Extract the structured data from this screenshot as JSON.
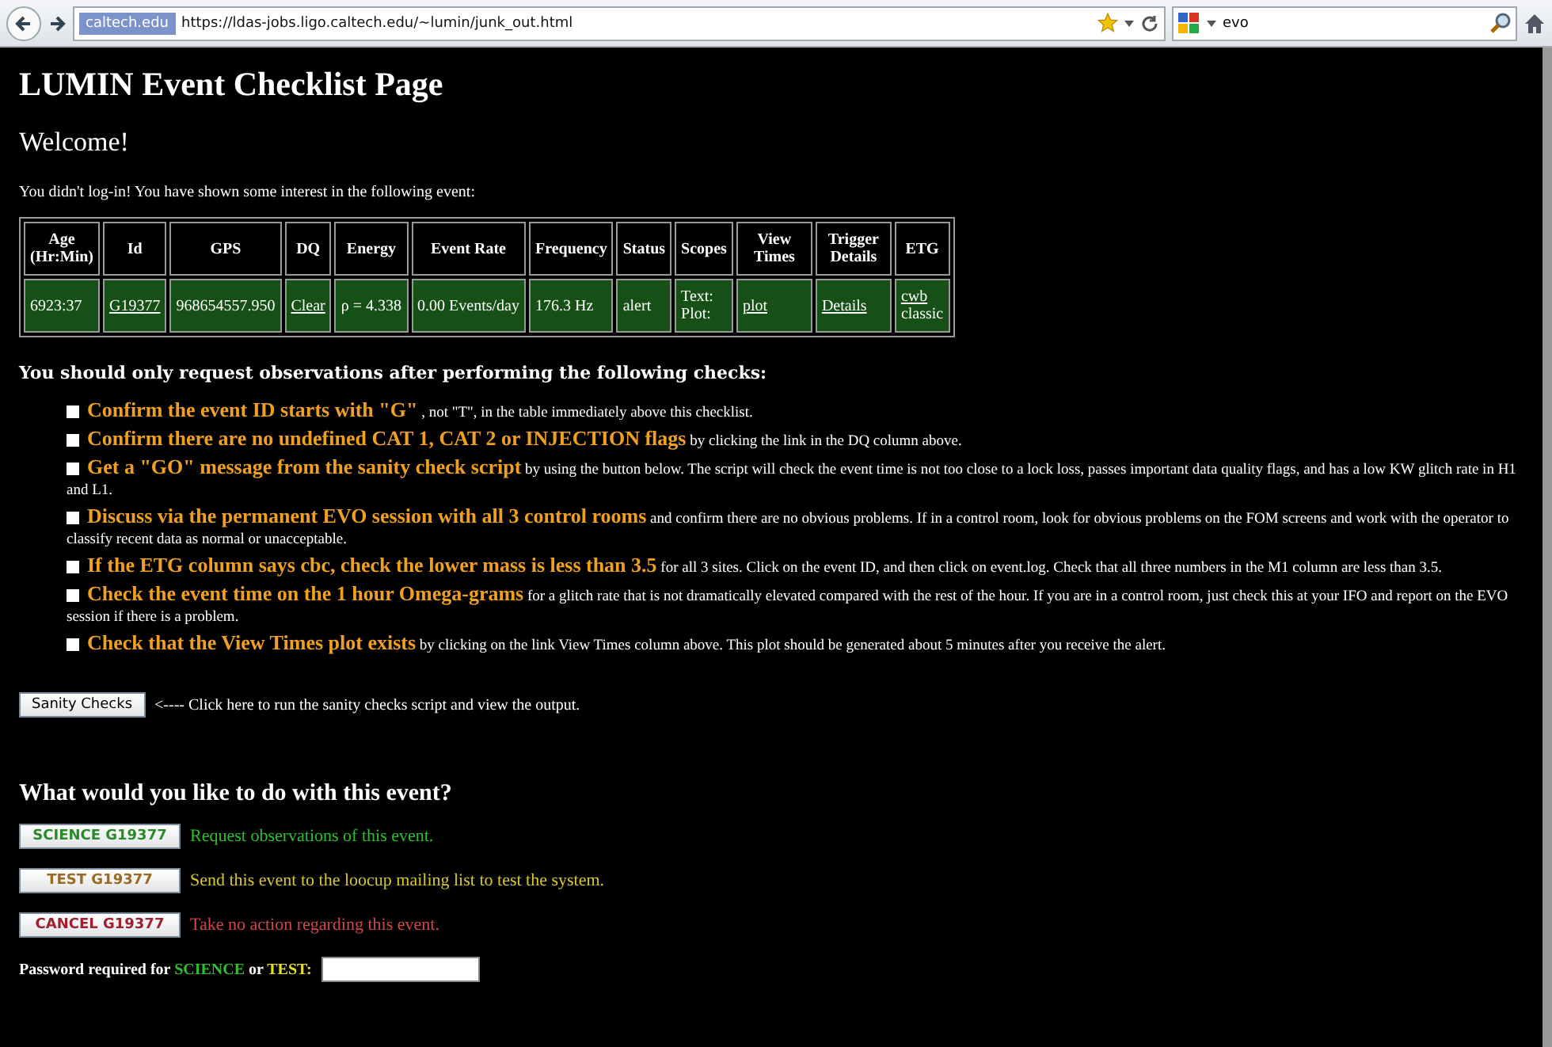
{
  "browser": {
    "site_badge": "caltech.edu",
    "url": "https://ldas-jobs.ligo.caltech.edu/~lumin/junk_out.html",
    "search_value": "evo"
  },
  "title": "LUMIN Event Checklist Page",
  "welcome": "Welcome!",
  "intro": "You didn't log-in! You have shown some interest in the following event:",
  "table": {
    "columns": [
      "Age (Hr:Min)",
      "Id",
      "GPS",
      "DQ",
      "Energy",
      "Event Rate",
      "Frequency",
      "Status",
      "Scopes",
      "View Times",
      "Trigger Details",
      "ETG"
    ],
    "rows": [
      [
        {
          "lines": [
            {
              "text": "6923:37",
              "link": false
            }
          ]
        },
        {
          "lines": [
            {
              "text": "G19377",
              "link": true
            }
          ]
        },
        {
          "lines": [
            {
              "text": "968654557.950",
              "link": false
            }
          ]
        },
        {
          "lines": [
            {
              "text": "Clear",
              "link": true
            }
          ]
        },
        {
          "lines": [
            {
              "text": "ρ = 4.338",
              "link": false
            }
          ]
        },
        {
          "lines": [
            {
              "text": "0.00 Events/day",
              "link": false
            }
          ]
        },
        {
          "lines": [
            {
              "text": "176.3 Hz",
              "link": false
            }
          ]
        },
        {
          "lines": [
            {
              "text": "alert",
              "link": false
            }
          ]
        },
        {
          "lines": [
            {
              "text": "Text:",
              "link": false
            },
            {
              "text": "Plot:",
              "link": false
            }
          ]
        },
        {
          "lines": [
            {
              "text": "plot",
              "link": true
            }
          ]
        },
        {
          "lines": [
            {
              "text": "Details",
              "link": true
            }
          ]
        },
        {
          "lines": [
            {
              "text": "cwb",
              "link": true
            },
            {
              "text": "classic",
              "link": false
            }
          ]
        }
      ]
    ]
  },
  "checks_heading": "You should only request observations after performing the following checks:",
  "checks": [
    {
      "checked": false,
      "title": "Confirm the event ID starts with \"G\"",
      "text": ", not \"T\", in the table immediately above this checklist."
    },
    {
      "checked": false,
      "title": "Confirm there are no undefined CAT 1, CAT 2 or INJECTION flags",
      "text": "by clicking the link in the DQ column above."
    },
    {
      "checked": false,
      "title": "Get a \"GO\" message from the sanity check script",
      "text": "by using the button below. The script will check the event time is not too close to a lock loss, passes important data quality flags, and has a low KW glitch rate in H1 and L1."
    },
    {
      "checked": false,
      "title": "Discuss via the permanent EVO session with all 3 control rooms",
      "text": "and confirm there are no obvious problems. If in a control room, look for obvious problems on the FOM screens and work with the operator to classify recent data as normal or unacceptable."
    },
    {
      "checked": false,
      "title": "If the ETG column says cbc, check the lower mass is less than 3.5",
      "text": "for all 3 sites. Click on the event ID, and then click on event.log. Check that all three numbers in the M1 column are less than 3.5."
    },
    {
      "checked": false,
      "title": "Check the event time on the 1 hour Omega-grams",
      "text": "for a glitch rate that is not dramatically elevated compared with the rest of the hour. If you are in a control room, just check this at your IFO and report on the EVO session if there is a problem."
    },
    {
      "checked": false,
      "title": "Check that the View Times plot exists",
      "text": "by clicking on the link View Times column above. This plot should be generated about 5 minutes after you receive the alert."
    }
  ],
  "sanity": {
    "button": "Sanity Checks",
    "note": "<---- Click here to run the sanity checks script and view the output."
  },
  "actions_heading": "What would you like to do with this event?",
  "actions": [
    {
      "kind": "science",
      "button": "SCIENCE G19377",
      "text": "Request observations of this event."
    },
    {
      "kind": "test",
      "button": "TEST G19377",
      "text": "Send this event to the loocup mailing list to test the system."
    },
    {
      "kind": "cancel",
      "button": "CANCEL G19377",
      "text": "Take no action regarding this event."
    }
  ],
  "password": {
    "label": "Password required for",
    "science": "SCIENCE",
    "or": "or",
    "test": "TEST:"
  }
}
